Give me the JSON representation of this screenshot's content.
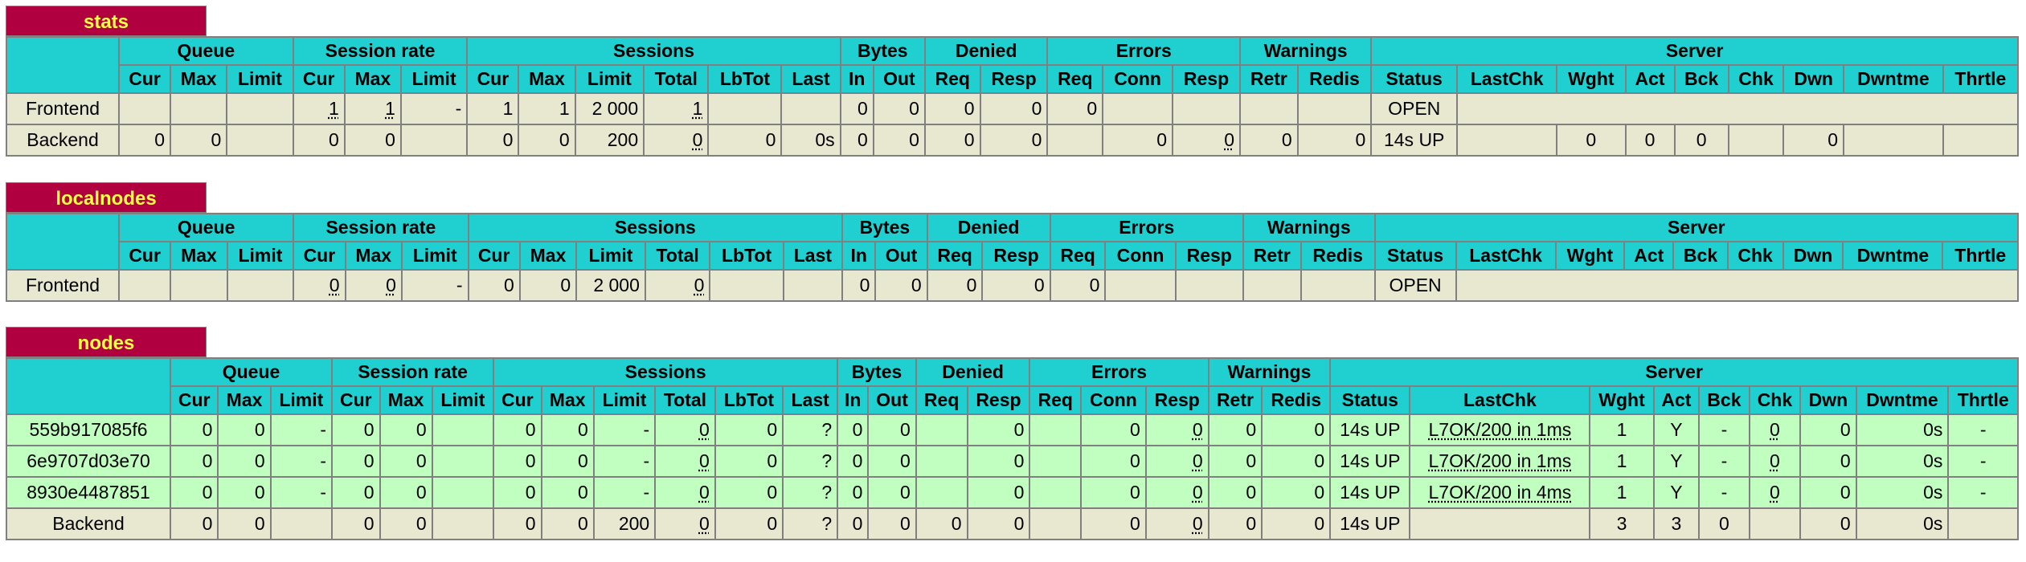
{
  "sections": [
    {
      "title": "stats",
      "groups": [
        "Queue",
        "Session rate",
        "Sessions",
        "Bytes",
        "Denied",
        "Errors",
        "Warnings",
        "Server"
      ],
      "cols": [
        "Cur",
        "Max",
        "Limit",
        "Cur",
        "Max",
        "Limit",
        "Cur",
        "Max",
        "Limit",
        "Total",
        "LbTot",
        "Last",
        "In",
        "Out",
        "Req",
        "Resp",
        "Req",
        "Conn",
        "Resp",
        "Retr",
        "Redis",
        "Status",
        "LastChk",
        "Wght",
        "Act",
        "Bck",
        "Chk",
        "Dwn",
        "Dwntme",
        "Thrtle"
      ],
      "frontend": {
        "name": "Frontend",
        "sr_cur": "1",
        "sr_max": "1",
        "sr_lim": "-",
        "s_cur": "1",
        "s_max": "1",
        "s_lim": "2 000",
        "s_tot": "1",
        "b_in": "0",
        "b_out": "0",
        "d_req": "0",
        "d_resp": "0",
        "e_req": "0",
        "status": "OPEN"
      },
      "backend": {
        "name": "Backend",
        "q_cur": "0",
        "q_max": "0",
        "sr_cur": "0",
        "sr_max": "0",
        "s_cur": "0",
        "s_max": "0",
        "s_lim": "200",
        "s_tot": "0",
        "lbtot": "0",
        "last": "0s",
        "b_in": "0",
        "b_out": "0",
        "d_req": "0",
        "d_resp": "0",
        "e_conn": "0",
        "e_resp": "0",
        "w_retr": "0",
        "w_redis": "0",
        "status": "14s UP",
        "wght": "0",
        "act": "0",
        "bck": "0",
        "dwn": "0"
      }
    },
    {
      "title": "localnodes",
      "frontend": {
        "name": "Frontend",
        "sr_cur": "0",
        "sr_max": "0",
        "sr_lim": "-",
        "s_cur": "0",
        "s_max": "0",
        "s_lim": "2 000",
        "s_tot": "0",
        "b_in": "0",
        "b_out": "0",
        "d_req": "0",
        "d_resp": "0",
        "e_req": "0",
        "status": "OPEN"
      }
    },
    {
      "title": "nodes",
      "servers": [
        {
          "name": "559b917085f6",
          "q_cur": "0",
          "q_max": "0",
          "q_lim": "-",
          "sr_cur": "0",
          "sr_max": "0",
          "s_cur": "0",
          "s_max": "0",
          "s_lim": "-",
          "s_tot": "0",
          "lbtot": "0",
          "last": "?",
          "b_in": "0",
          "b_out": "0",
          "d_resp": "0",
          "e_conn": "0",
          "e_resp": "0",
          "w_retr": "0",
          "w_redis": "0",
          "status": "14s UP",
          "lastchk": "L7OK/200 in 1ms",
          "wght": "1",
          "act": "Y",
          "bck": "-",
          "chk": "0",
          "dwn": "0",
          "dwntme": "0s",
          "thrtle": "-"
        },
        {
          "name": "6e9707d03e70",
          "q_cur": "0",
          "q_max": "0",
          "q_lim": "-",
          "sr_cur": "0",
          "sr_max": "0",
          "s_cur": "0",
          "s_max": "0",
          "s_lim": "-",
          "s_tot": "0",
          "lbtot": "0",
          "last": "?",
          "b_in": "0",
          "b_out": "0",
          "d_resp": "0",
          "e_conn": "0",
          "e_resp": "0",
          "w_retr": "0",
          "w_redis": "0",
          "status": "14s UP",
          "lastchk": "L7OK/200 in 1ms",
          "wght": "1",
          "act": "Y",
          "bck": "-",
          "chk": "0",
          "dwn": "0",
          "dwntme": "0s",
          "thrtle": "-"
        },
        {
          "name": "8930e4487851",
          "q_cur": "0",
          "q_max": "0",
          "q_lim": "-",
          "sr_cur": "0",
          "sr_max": "0",
          "s_cur": "0",
          "s_max": "0",
          "s_lim": "-",
          "s_tot": "0",
          "lbtot": "0",
          "last": "?",
          "b_in": "0",
          "b_out": "0",
          "d_resp": "0",
          "e_conn": "0",
          "e_resp": "0",
          "w_retr": "0",
          "w_redis": "0",
          "status": "14s UP",
          "lastchk": "L7OK/200 in 4ms",
          "wght": "1",
          "act": "Y",
          "bck": "-",
          "chk": "0",
          "dwn": "0",
          "dwntme": "0s",
          "thrtle": "-"
        }
      ],
      "backend": {
        "name": "Backend",
        "q_cur": "0",
        "q_max": "0",
        "sr_cur": "0",
        "sr_max": "0",
        "s_cur": "0",
        "s_max": "0",
        "s_lim": "200",
        "s_tot": "0",
        "lbtot": "0",
        "last": "?",
        "b_in": "0",
        "b_out": "0",
        "d_req": "0",
        "d_resp": "0",
        "e_conn": "0",
        "e_resp": "0",
        "w_retr": "0",
        "w_redis": "0",
        "status": "14s UP",
        "wght": "3",
        "act": "3",
        "bck": "0",
        "dwn": "0",
        "dwntme": "0s"
      }
    }
  ],
  "colors": {
    "title_bg": "#b00040",
    "title_fg": "#ffff40",
    "header_bg": "#20d0d0",
    "row_bg": "#e8e8d0",
    "server_up_bg": "#c0ffc0"
  }
}
